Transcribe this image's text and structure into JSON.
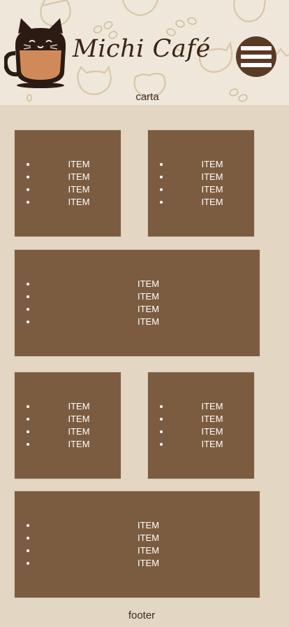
{
  "header": {
    "brand": "Michi Café",
    "subtitle": "carta"
  },
  "icons": {
    "logo": "cat-coffee-cup-logo",
    "menu": "hamburger-menu-icon"
  },
  "colors": {
    "header_background": "#efe7da",
    "page_background": "#e3d6c2",
    "card": "#7c5c41",
    "menu_button": "#5a3a26",
    "text": "#3b2b22"
  },
  "cards": [
    {
      "items": [
        "ITEM",
        "ITEM",
        "ITEM",
        "ITEM"
      ]
    },
    {
      "items": [
        "ITEM",
        "ITEM",
        "ITEM",
        "ITEM"
      ]
    },
    {
      "items": [
        "ITEM",
        "ITEM",
        "ITEM",
        "ITEM"
      ]
    },
    {
      "items": [
        "ITEM",
        "ITEM",
        "ITEM",
        "ITEM"
      ]
    },
    {
      "items": [
        "ITEM",
        "ITEM",
        "ITEM",
        "ITEM"
      ]
    },
    {
      "items": [
        "ITEM",
        "ITEM",
        "ITEM",
        "ITEM"
      ]
    }
  ],
  "footer": {
    "text": "footer"
  }
}
